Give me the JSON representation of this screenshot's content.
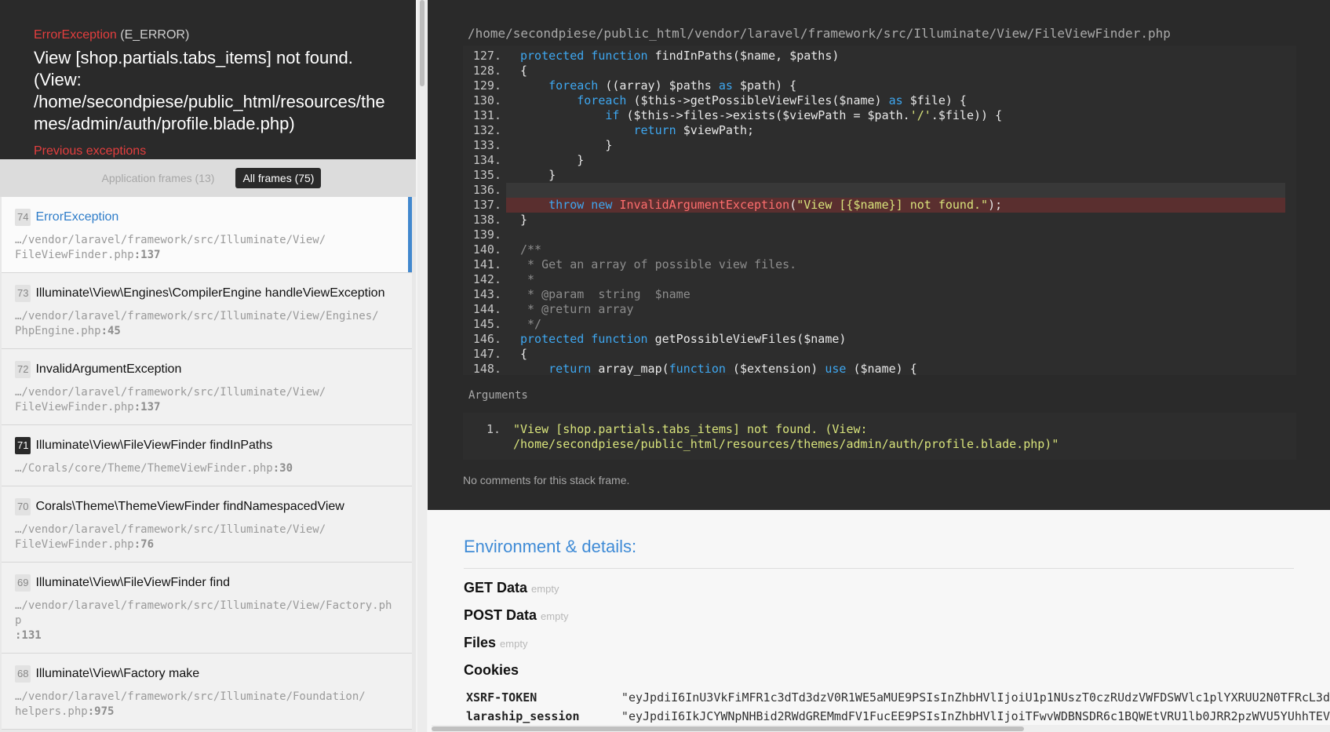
{
  "exception": {
    "class": "ErrorException",
    "type": "(E_ERROR)",
    "message": "View [shop.partials.tabs_items] not found. (View: /home/secondpiese/public_html/resources/themes/admin/auth/profile.blade.php)",
    "previous_label": "Previous exceptions"
  },
  "filters": {
    "application": "Application frames (13)",
    "all": "All frames (75)"
  },
  "frames": [
    {
      "index": "74",
      "class": "ErrorException",
      "path": "…/vendor/laravel/framework/src/Illuminate/View/\nFileViewFinder.php",
      "line": ":137"
    },
    {
      "index": "73",
      "class": "Illuminate\\View\\Engines\\CompilerEngine handleViewException",
      "path": "…/vendor/laravel/framework/src/Illuminate/View/Engines/\nPhpEngine.php",
      "line": ":45"
    },
    {
      "index": "72",
      "class": "InvalidArgumentException",
      "path": "…/vendor/laravel/framework/src/Illuminate/View/\nFileViewFinder.php",
      "line": ":137"
    },
    {
      "index": "71",
      "class": "Illuminate\\View\\FileViewFinder findInPaths",
      "path": "…/Corals/core/Theme/ThemeViewFinder.php",
      "line": ":30"
    },
    {
      "index": "70",
      "class": "Corals\\Theme\\ThemeViewFinder findNamespacedView",
      "path": "…/vendor/laravel/framework/src/Illuminate/View/\nFileViewFinder.php",
      "line": ":76"
    },
    {
      "index": "69",
      "class": "Illuminate\\View\\FileViewFinder find",
      "path": "…/vendor/laravel/framework/src/Illuminate/View/Factory.php\n",
      "line": ":131"
    },
    {
      "index": "68",
      "class": "Illuminate\\View\\Factory make",
      "path": "…/vendor/laravel/framework/src/Illuminate/Foundation/\nhelpers.php",
      "line": ":975"
    }
  ],
  "file_path": "/home/secondpiese/public_html/vendor/laravel/framework/src/Illuminate/View/FileViewFinder.php",
  "code_lines": [
    {
      "n": "127.",
      "text": "    protected function findInPaths($name, $paths)"
    },
    {
      "n": "128.",
      "text": "    {"
    },
    {
      "n": "129.",
      "text": "        foreach ((array) $paths as $path) {"
    },
    {
      "n": "130.",
      "text": "            foreach ($this->getPossibleViewFiles($name) as $file) {"
    },
    {
      "n": "131.",
      "text": "                if ($this->files->exists($viewPath = $path.'/'.$file)) {"
    },
    {
      "n": "132.",
      "text": "                    return $viewPath;"
    },
    {
      "n": "133.",
      "text": "                }"
    },
    {
      "n": "134.",
      "text": "            }"
    },
    {
      "n": "135.",
      "text": "        }"
    },
    {
      "n": "136.",
      "text": ""
    },
    {
      "n": "137.",
      "text": "        throw new InvalidArgumentException(\"View [{$name}] not found.\");"
    },
    {
      "n": "138.",
      "text": "    }"
    },
    {
      "n": "139.",
      "text": ""
    },
    {
      "n": "140.",
      "text": "    /**"
    },
    {
      "n": "141.",
      "text": "     * Get an array of possible view files."
    },
    {
      "n": "142.",
      "text": "     *"
    },
    {
      "n": "143.",
      "text": "     * @param  string  $name"
    },
    {
      "n": "144.",
      "text": "     * @return array"
    },
    {
      "n": "145.",
      "text": "     */"
    },
    {
      "n": "146.",
      "text": "    protected function getPossibleViewFiles($name)"
    },
    {
      "n": "147.",
      "text": "    {"
    },
    {
      "n": "148.",
      "text": "        return array_map(function ($extension) use ($name) {"
    }
  ],
  "arguments": {
    "title": "Arguments",
    "items": [
      {
        "n": "1.",
        "value": "\"View [shop.partials.tabs_items] not found. (View: /home/secondpiese/public_html/resources/themes/admin/auth/profile.blade.php)\""
      }
    ]
  },
  "no_comments": "No comments for this stack frame.",
  "env": {
    "title": "Environment & details:",
    "get_data": "GET Data",
    "post_data": "POST Data",
    "files": "Files",
    "cookies": "Cookies",
    "empty": "empty",
    "cookie_rows": [
      {
        "key": "XSRF-TOKEN",
        "value": "\"eyJpdiI6InU3VkFiMFR1c3dTd3dzV0R1WE5aMUE9PSIsInZhbHVlIjoiU1p1NUszT0czRUdzVWFDSWVlc1plYXRUU2N0TFRcL3d"
      },
      {
        "key": "laraship_session",
        "value": "\"eyJpdiI6IkJCYWNpNHBid2RWdGREMmdFV1FucEE9PSIsInZhbHVlIjoiTFwvWDBNSDR6c1BQWEtVRU1lb0JRR2pzWVU5YUhhTEV"
      }
    ]
  },
  "colors": {
    "accent_blue": "#4288ce",
    "error_red": "#e33e3e",
    "dark_bg": "#2a2a2a"
  }
}
